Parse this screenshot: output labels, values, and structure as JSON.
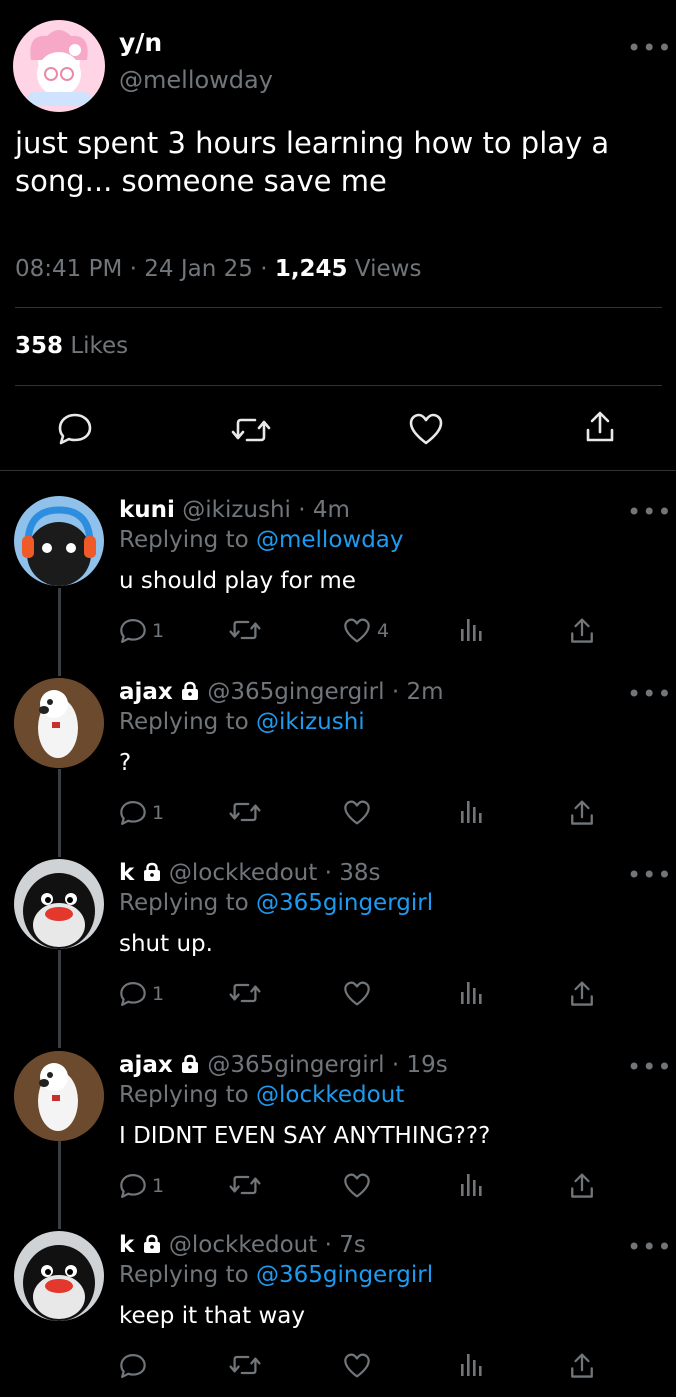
{
  "main": {
    "name": "y/n",
    "handle": "@mellowday",
    "text": "just spent 3 hours learning how to play a song... someone save me",
    "time": "08:41 PM",
    "date": "24 Jan 25",
    "views_count": "1,245",
    "views_label": "Views",
    "likes_count": "358",
    "likes_label": "Likes"
  },
  "replies": [
    {
      "name": "kuni",
      "handle": "@ikizushi",
      "age": "4m",
      "replying_prefix": "Replying to",
      "replying_to": "@mellowday",
      "text": "u should play for me",
      "reply_count": "1",
      "like_count": "4",
      "locked": false
    },
    {
      "name": "ajax",
      "handle": "@365gingergirl",
      "age": "2m",
      "replying_prefix": "Replying to",
      "replying_to": "@ikizushi",
      "text": "?",
      "reply_count": "1",
      "like_count": "",
      "locked": true
    },
    {
      "name": "k",
      "handle": "@lockkedout",
      "age": "38s",
      "replying_prefix": "Replying to",
      "replying_to": "@365gingergirl",
      "text": "shut up.",
      "reply_count": "1",
      "like_count": "",
      "locked": true
    },
    {
      "name": "ajax",
      "handle": "@365gingergirl",
      "age": "19s",
      "replying_prefix": "Replying to",
      "replying_to": "@lockkedout",
      "text": "I DIDNT EVEN SAY ANYTHING???",
      "reply_count": "1",
      "like_count": "",
      "locked": true
    },
    {
      "name": "k",
      "handle": "@lockkedout",
      "age": "7s",
      "replying_prefix": "Replying to",
      "replying_to": "@365gingergirl",
      "text": "keep it that way",
      "reply_count": "",
      "like_count": "",
      "locked": true
    }
  ],
  "icons": {
    "more": "more-horizontal-icon",
    "reply": "speech-bubble-icon",
    "retweet": "retweet-icon",
    "like": "heart-icon",
    "views": "bar-chart-icon",
    "share": "share-upload-icon",
    "lock": "lock-icon"
  },
  "colors": {
    "background": "#000000",
    "text": "#e7e9ea",
    "muted": "#71767b",
    "link": "#1d9bf0",
    "divider": "#2f3336"
  },
  "separator": "·"
}
